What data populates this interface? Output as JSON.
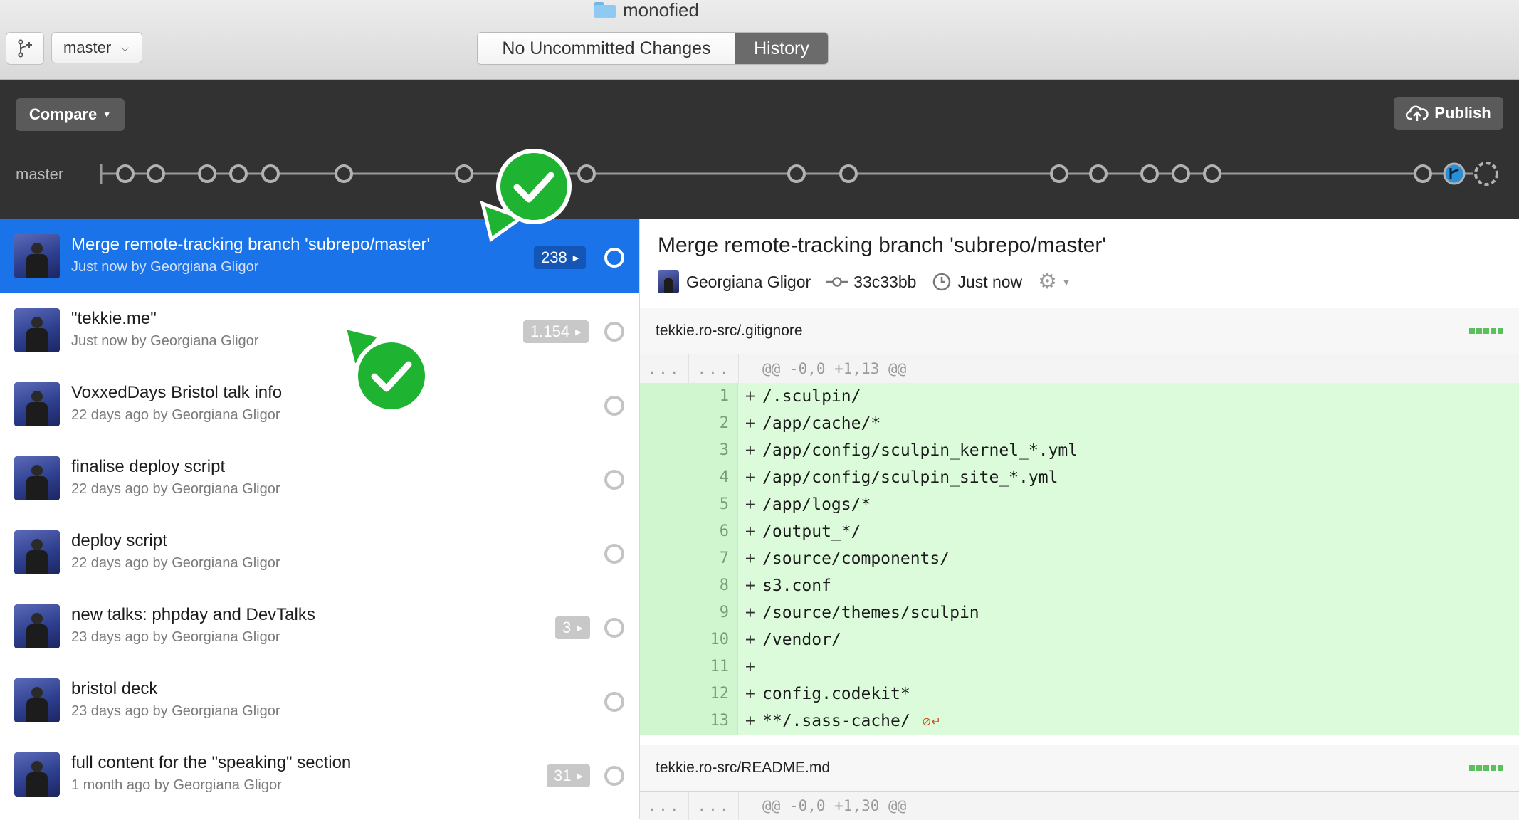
{
  "window": {
    "title": "monofied"
  },
  "toolbar": {
    "branch": "master",
    "segments": [
      "No Uncommitted Changes",
      "History"
    ],
    "active_segment": "History"
  },
  "graph": {
    "compare_label": "Compare",
    "publish_label": "Publish",
    "branch_label": "master"
  },
  "commits": [
    {
      "title": "Merge remote-tracking branch 'subrepo/master'",
      "subtitle": "Just now by Georgiana Gligor",
      "badge": "238",
      "selected": true
    },
    {
      "title": "\"tekkie.me\"",
      "subtitle": "Just now by Georgiana Gligor",
      "badge": "1.154"
    },
    {
      "title": "VoxxedDays Bristol talk info",
      "subtitle": "22 days ago by Georgiana Gligor",
      "badge": ""
    },
    {
      "title": "finalise deploy script",
      "subtitle": "22 days ago by Georgiana Gligor",
      "badge": ""
    },
    {
      "title": "deploy script",
      "subtitle": "22 days ago by Georgiana Gligor",
      "badge": ""
    },
    {
      "title": "new talks: phpday and DevTalks",
      "subtitle": "23 days ago by Georgiana Gligor",
      "badge": "3"
    },
    {
      "title": "bristol deck",
      "subtitle": "23 days ago by Georgiana Gligor",
      "badge": ""
    },
    {
      "title": "full content for the \"speaking\" section",
      "subtitle": "1 month ago by Georgiana Gligor",
      "badge": "31"
    }
  ],
  "detail": {
    "title": "Merge remote-tracking branch 'subrepo/master'",
    "author": "Georgiana Gligor",
    "sha": "33c33bb",
    "time": "Just now"
  },
  "files": [
    {
      "name": "tekkie.ro-src/.gitignore",
      "hunk_old": "...",
      "hunk_new": "...",
      "hunk": "@@ -0,0 +1,13 @@",
      "lines": [
        {
          "n": "1",
          "text": "/.sculpin/"
        },
        {
          "n": "2",
          "text": "/app/cache/*"
        },
        {
          "n": "3",
          "text": "/app/config/sculpin_kernel_*.yml"
        },
        {
          "n": "4",
          "text": "/app/config/sculpin_site_*.yml"
        },
        {
          "n": "5",
          "text": "/app/logs/*"
        },
        {
          "n": "6",
          "text": "/output_*/"
        },
        {
          "n": "7",
          "text": "/source/components/"
        },
        {
          "n": "8",
          "text": "s3.conf"
        },
        {
          "n": "9",
          "text": "/source/themes/sculpin"
        },
        {
          "n": "10",
          "text": "/vendor/"
        },
        {
          "n": "11",
          "text": ""
        },
        {
          "n": "12",
          "text": "config.codekit*"
        },
        {
          "n": "13",
          "text": "**/.sass-cache/"
        }
      ]
    },
    {
      "name": "tekkie.ro-src/README.md",
      "hunk_old": "...",
      "hunk_new": "...",
      "hunk": "@@ -0,0 +1,30 @@"
    }
  ],
  "colors": {
    "selection": "#1a73e8",
    "graph_bg": "#323232",
    "diff_add": "#dbfbdb",
    "callout": "#1fb332"
  }
}
